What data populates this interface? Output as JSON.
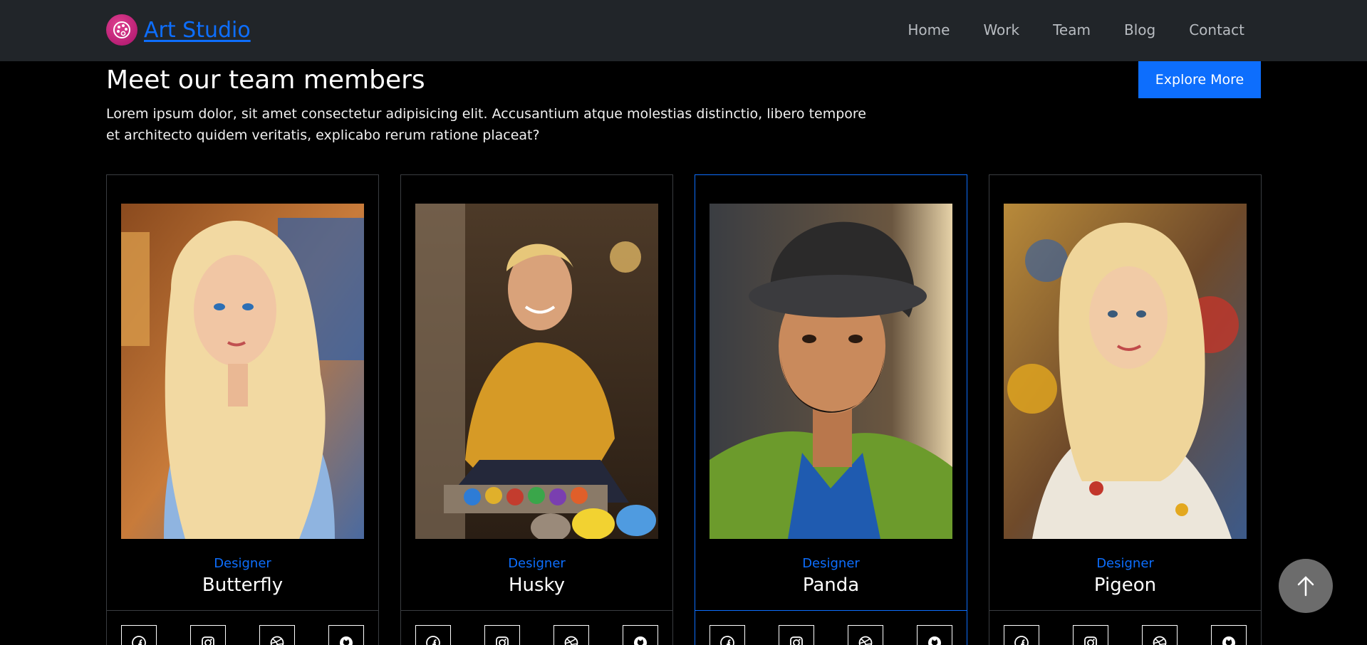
{
  "brand": {
    "name": "Art Studio"
  },
  "nav": {
    "items": [
      "Home",
      "Work",
      "Team",
      "Blog",
      "Contact"
    ]
  },
  "section": {
    "title": "Meet our team members",
    "description": "Lorem ipsum dolor, sit amet consectetur adipisicing elit. Accusantium atque molestias distinctio, libero tempore et architecto quidem veritatis, explicabo rerum ratione placeat?",
    "cta_label": "Explore More"
  },
  "team": [
    {
      "role": "Designer",
      "name": "Butterfly"
    },
    {
      "role": "Designer",
      "name": "Husky"
    },
    {
      "role": "Designer",
      "name": "Panda"
    },
    {
      "role": "Designer",
      "name": "Pigeon"
    }
  ],
  "social_icons": [
    "facebook-icon",
    "instagram-icon",
    "dribbble-icon",
    "github-icon"
  ],
  "colors": {
    "accent": "#0d6efd",
    "navbar": "#212529",
    "logo": "#c2187a"
  }
}
